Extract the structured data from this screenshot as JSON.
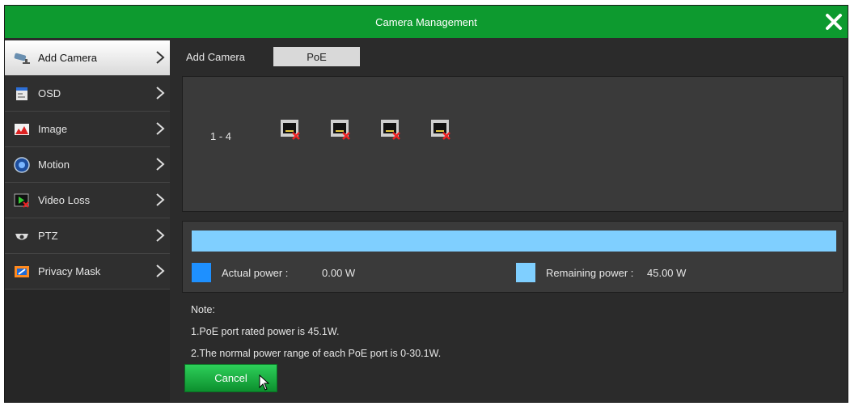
{
  "window": {
    "title": "Camera Management"
  },
  "sidebar": {
    "items": [
      {
        "label": "Add Camera",
        "icon": "camera-icon",
        "active": true
      },
      {
        "label": "OSD",
        "icon": "osd-icon"
      },
      {
        "label": "Image",
        "icon": "image-icon"
      },
      {
        "label": "Motion",
        "icon": "motion-icon"
      },
      {
        "label": "Video Loss",
        "icon": "video-loss-icon"
      },
      {
        "label": "PTZ",
        "icon": "ptz-icon"
      },
      {
        "label": "Privacy Mask",
        "icon": "privacy-mask-icon"
      }
    ]
  },
  "tabs": {
    "add_camera": "Add Camera",
    "poe": "PoE"
  },
  "ports": {
    "range_label": "1 - 4",
    "count": 4,
    "status": "disconnected"
  },
  "power": {
    "actual_label": "Actual power :",
    "actual_value": "0.00 W",
    "remaining_label": "Remaining power :",
    "remaining_value": "45.00 W",
    "actual_color": "#1e90ff",
    "remaining_color": "#7fcfff"
  },
  "notes": {
    "heading": "Note:",
    "line1": "1.PoE port rated power is 45.1W.",
    "line2": "2.The normal power range of each PoE port is 0-30.1W."
  },
  "buttons": {
    "cancel": "Cancel"
  },
  "colors": {
    "accent": "#0d9a2f"
  }
}
